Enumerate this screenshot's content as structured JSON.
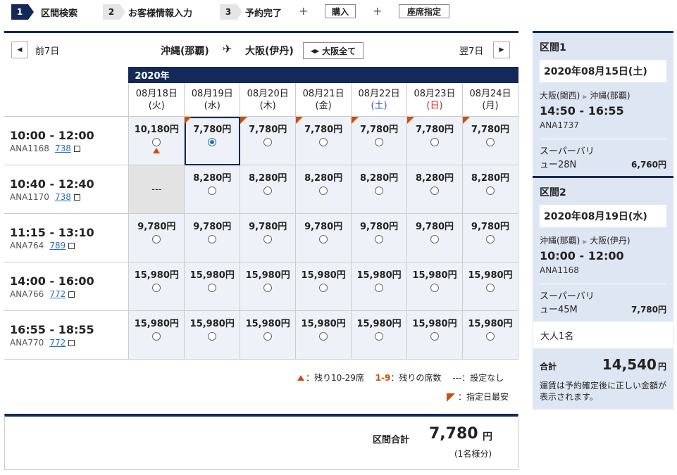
{
  "steps": [
    {
      "num": "1",
      "label": "区間検索",
      "active": true
    },
    {
      "num": "2",
      "label": "お客様情報入力",
      "active": false
    },
    {
      "num": "3",
      "label": "予約完了",
      "active": false
    }
  ],
  "extra_steps": {
    "plus": "+",
    "purchase": "購入",
    "seat": "座席指定"
  },
  "nav": {
    "prev": "前7日",
    "next": "翌7日",
    "origin": "沖縄(那覇)",
    "destination": "大阪(伊丹)",
    "all_osaka": "大阪全て"
  },
  "year": "2020年",
  "dates": [
    {
      "date": "08月18日",
      "dow": "(火)"
    },
    {
      "date": "08月19日",
      "dow": "(水)"
    },
    {
      "date": "08月20日",
      "dow": "(木)"
    },
    {
      "date": "08月21日",
      "dow": "(金)"
    },
    {
      "date": "08月22日",
      "dow": "(土)"
    },
    {
      "date": "08月23日",
      "dow": "(日)"
    },
    {
      "date": "08月24日",
      "dow": "(月)"
    }
  ],
  "flights": [
    {
      "time": "10:00 - 12:00",
      "number": "ANA1168",
      "aircraft": "738",
      "prices": [
        "10,180円",
        "7,780円",
        "7,780円",
        "7,780円",
        "7,780円",
        "7,780円",
        "7,780円"
      ]
    },
    {
      "time": "10:40 - 12:40",
      "number": "ANA1170",
      "aircraft": "738",
      "prices": [
        "---",
        "8,280円",
        "8,280円",
        "8,280円",
        "8,280円",
        "8,280円",
        "8,280円"
      ]
    },
    {
      "time": "11:15 - 13:10",
      "number": "ANA764",
      "aircraft": "789",
      "prices": [
        "9,780円",
        "9,780円",
        "9,780円",
        "9,780円",
        "9,780円",
        "9,780円",
        "9,780円"
      ]
    },
    {
      "time": "14:00 - 16:00",
      "number": "ANA766",
      "aircraft": "772",
      "prices": [
        "15,980円",
        "15,980円",
        "15,980円",
        "15,980円",
        "15,980円",
        "15,980円",
        "15,980円"
      ]
    },
    {
      "time": "16:55 - 18:55",
      "number": "ANA770",
      "aircraft": "772",
      "prices": [
        "15,980円",
        "15,980円",
        "15,980円",
        "15,980円",
        "15,980円",
        "15,980円",
        "15,980円"
      ]
    }
  ],
  "legend": {
    "few_seats": "：残り10-29席",
    "seat_count_key": "1-9",
    "seat_count": "：残りの席数",
    "none_key": "---",
    "none": "：設定なし",
    "cheapest": "：指定日最安"
  },
  "total": {
    "label": "区間合計",
    "amount": "7,780",
    "unit": "円",
    "note": "(1名様分)"
  },
  "sidebar": {
    "sections": [
      {
        "title": "区間1",
        "date": "2020年08月15日(土)",
        "from": "大阪(関西)",
        "to": "沖縄(那覇)",
        "time": "14:50 - 16:55",
        "flight": "ANA1737",
        "fare_line1": "スーパーバリ",
        "fare_line2": "ュー28N",
        "fare": "6,760円"
      },
      {
        "title": "区間2",
        "date": "2020年08月19日(水)",
        "from": "沖縄(那覇)",
        "to": "大阪(伊丹)",
        "time": "10:00 - 12:00",
        "flight": "ANA1168",
        "fare_line1": "スーパーバリ",
        "fare_line2": "ュー45M",
        "fare": "7,780円"
      }
    ],
    "passengers": "大人1名",
    "sum_label": "合計",
    "sum_amount": "14,540",
    "sum_unit": "円",
    "note": "運賃は予約確定後に正しい金額が表示されます。"
  },
  "colors": {
    "navy": "#14295a",
    "accent_orange": "#c9500f",
    "link_blue": "#2a6ebb",
    "sat_blue": "#2a5cc8",
    "sun_red": "#c8281e"
  }
}
